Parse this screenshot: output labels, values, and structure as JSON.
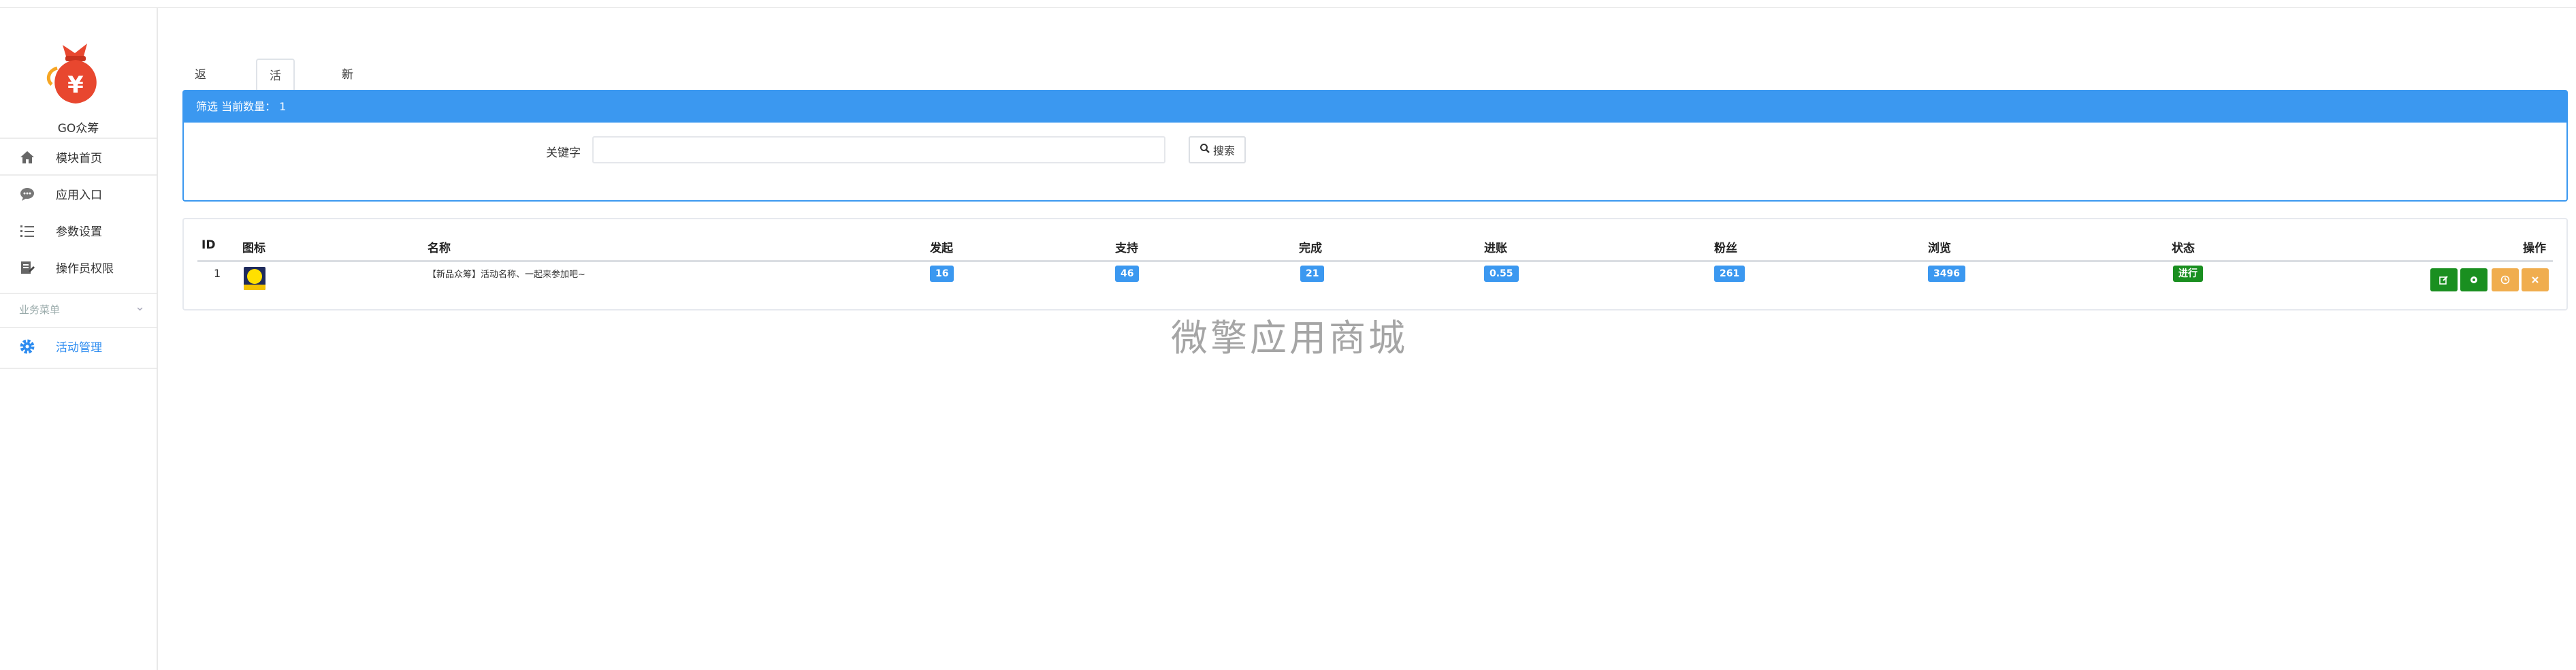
{
  "sidebar": {
    "app_name": "GO众筹",
    "nav": [
      {
        "label": "模块首页",
        "icon": "home-icon"
      },
      {
        "label": "应用入口",
        "icon": "chat-bubble-icon"
      },
      {
        "label": "参数设置",
        "icon": "list-icon"
      },
      {
        "label": "操作员权限",
        "icon": "edit-document-icon"
      }
    ],
    "section_title": "业务菜单",
    "section_items": [
      {
        "label": "活动管理",
        "icon": "gear-icon",
        "active": true
      }
    ]
  },
  "tabs": [
    {
      "label": "返回菜单"
    },
    {
      "label": "活动列表",
      "active": true
    },
    {
      "label": "新增活动"
    }
  ],
  "filter": {
    "header": "筛选 当前数量： 1",
    "keyword_label": "关键字",
    "keyword_value": "",
    "search_label": "搜索"
  },
  "table": {
    "columns": [
      "ID",
      "图标",
      "名称",
      "发起",
      "支持",
      "完成",
      "进账",
      "粉丝",
      "浏览",
      "状态",
      "操作"
    ],
    "rows": [
      {
        "id": "1",
        "name": "【新品众筹】活动名称、一起来参加吧~",
        "initiated": "16",
        "support": "46",
        "completed": "21",
        "income": "0.55",
        "fans": "261",
        "views": "3496",
        "status": "进行"
      }
    ]
  },
  "watermark": "微擎应用商城",
  "colors": {
    "accent": "#3b98f0",
    "success": "#1a8f20",
    "warning": "#f0ad4e"
  }
}
